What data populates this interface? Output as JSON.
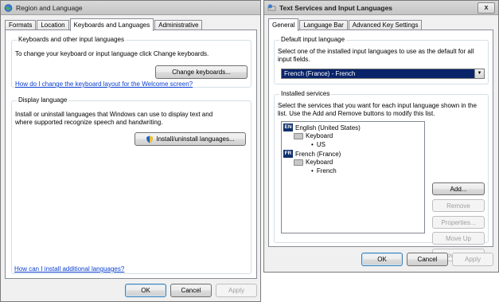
{
  "region_window": {
    "title": "Region and Language",
    "tabs": [
      "Formats",
      "Location",
      "Keyboards and Languages",
      "Administrative"
    ],
    "keyboards_group": {
      "legend": "Keyboards and other input languages",
      "description": "To change your keyboard or input language click Change keyboards.",
      "button": "Change keyboards...",
      "link": "How do I change the keyboard layout for the Welcome screen?"
    },
    "display_group": {
      "legend": "Display language",
      "description": "Install or uninstall languages that Windows can use to display text and where supported recognize speech and handwriting.",
      "button": "Install/uninstall languages..."
    },
    "bottom_link": "How can I install additional languages?",
    "buttons": {
      "ok": "OK",
      "cancel": "Cancel",
      "apply": "Apply"
    }
  },
  "text_services_window": {
    "title": "Text Services and Input Languages",
    "close": "x",
    "tabs": [
      "General",
      "Language Bar",
      "Advanced Key Settings"
    ],
    "default_group": {
      "legend": "Default input language",
      "description": "Select one of the installed input languages to use as the default for all input fields.",
      "selected": "French (France) - French"
    },
    "installed_group": {
      "legend": "Installed services",
      "description": "Select the services that you want for each input language shown in the list. Use the Add and Remove buttons to modify this list.",
      "tree": {
        "lang1": {
          "badge": "EN",
          "name": "English (United States)",
          "category": "Keyboard",
          "item": "US"
        },
        "lang2": {
          "badge": "FR",
          "name": "French (France)",
          "category": "Keyboard",
          "item": "French"
        }
      },
      "buttons": {
        "add": "Add...",
        "remove": "Remove",
        "properties": "Properties...",
        "move_up": "Move Up",
        "move_down": "Move Down"
      }
    },
    "buttons": {
      "ok": "OK",
      "cancel": "Cancel",
      "apply": "Apply"
    }
  }
}
